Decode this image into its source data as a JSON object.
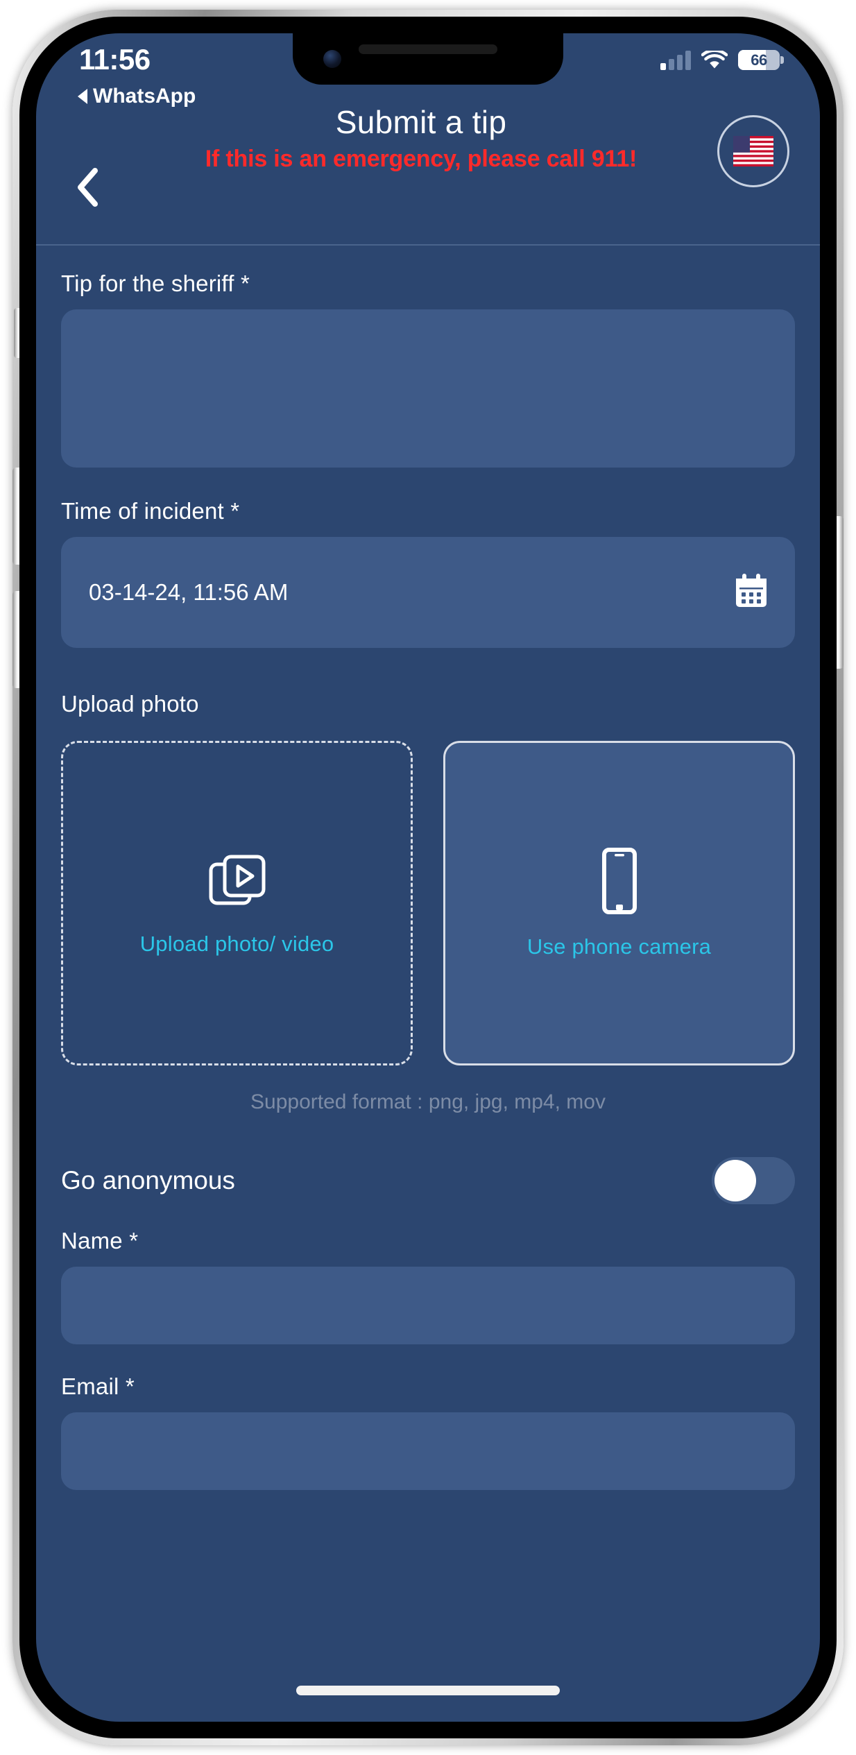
{
  "status_bar": {
    "time": "11:56",
    "battery_percent": "66",
    "battery_level": 66,
    "signal_icon": "cellular-signal-icon",
    "wifi_icon": "wifi-icon",
    "battery_icon": "battery-icon"
  },
  "back_to_app": {
    "label": "WhatsApp",
    "icon": "back-triangle-icon"
  },
  "header": {
    "title": "Submit a tip",
    "emergency_notice": "If this is an emergency, please call 911!",
    "back_icon": "chevron-left-icon",
    "flag_icon": "us-flag-icon",
    "flag_glyph": "🇺🇸"
  },
  "form": {
    "tip": {
      "label": "Tip for the sheriff *",
      "value": "",
      "placeholder": ""
    },
    "time_of_incident": {
      "label": "Time of incident *",
      "value": "03-14-24, 11:56 AM",
      "calendar_icon": "calendar-icon"
    },
    "upload": {
      "label": "Upload photo",
      "file_card": {
        "caption": "Upload photo/ video",
        "icon": "media-stack-play-icon"
      },
      "camera_card": {
        "caption": "Use phone camera",
        "icon": "smartphone-icon"
      },
      "supported_format": "Supported format : png, jpg, mp4, mov"
    },
    "anonymous": {
      "label": "Go anonymous",
      "enabled": false
    },
    "name": {
      "label": "Name *",
      "value": "",
      "placeholder": ""
    },
    "email": {
      "label": "Email *",
      "value": "",
      "placeholder": ""
    }
  },
  "colors": {
    "screen_background": "#2c4670",
    "input_background": "#3e5a88",
    "accent_cyan": "#2bc6e8",
    "emergency_red": "#ff2a2a",
    "muted_text": "#7d8ca6",
    "border_light": "#d9dee8"
  }
}
